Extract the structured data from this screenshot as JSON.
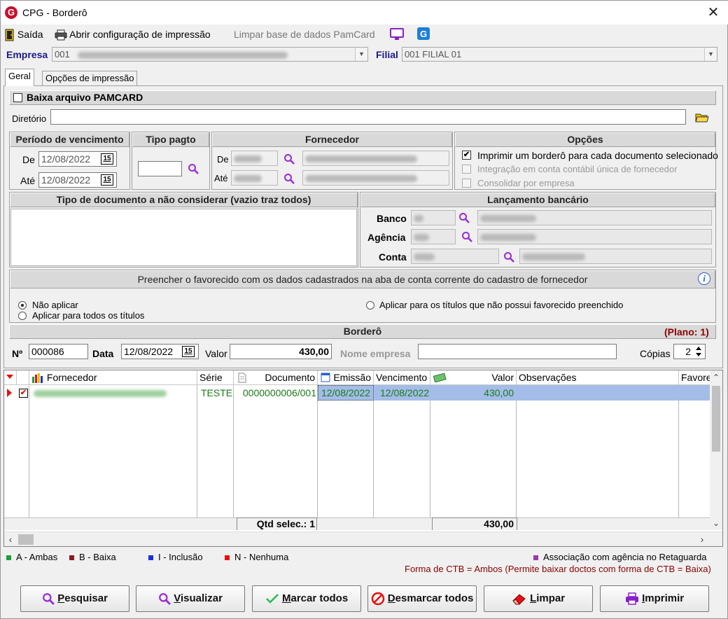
{
  "window": {
    "title": "CPG - Borderô",
    "close_glyph": "✕"
  },
  "toolbar": {
    "exit_label": "Saída",
    "print_config_label": "Abrir configuração de impressão",
    "clear_pamcard_label": "Limpar base de dados PamCard"
  },
  "company": {
    "empresa_label": "Empresa",
    "empresa_code": "001",
    "filial_label": "Filial",
    "filial_value": "001 FILIAL 01"
  },
  "tabs": [
    {
      "label": "Geral",
      "active": true
    },
    {
      "label": "Opções de impressão",
      "active": false
    }
  ],
  "pamcard": {
    "checkbox_label": "Baixa arquivo PAMCARD",
    "checked": false,
    "directory_label": "Diretório",
    "directory_value": ""
  },
  "periodo": {
    "title": "Período de vencimento",
    "from_label": "De",
    "from_value": "12/08/2022",
    "to_label": "Até",
    "to_value": "12/08/2022",
    "calendar_glyph": "15"
  },
  "tipo_pagto": {
    "title": "Tipo pagto",
    "value": ""
  },
  "fornecedor_filter": {
    "title": "Fornecedor",
    "from_label": "De",
    "to_label": "Até"
  },
  "opcoes": {
    "title": "Opções",
    "items": [
      {
        "label": "Imprimir um borderô para cada documento selecionado",
        "checked": true,
        "enabled": true
      },
      {
        "label": "Integração em conta contábil única de fornecedor",
        "checked": false,
        "enabled": false
      },
      {
        "label": "Consolidar por empresa",
        "checked": false,
        "enabled": false
      }
    ]
  },
  "tipo_documento": {
    "title": "Tipo de documento a não considerar (vazio traz todos)"
  },
  "lancamento": {
    "title": "Lançamento bancário",
    "banco_label": "Banco",
    "agencia_label": "Agência",
    "conta_label": "Conta"
  },
  "favorecido": {
    "title": "Preencher o favorecido com os dados cadastrados na aba de conta corrente do cadastro de fornecedor",
    "info_glyph": "i",
    "options": [
      {
        "label": "Não aplicar",
        "selected": true
      },
      {
        "label": "Aplicar para todos os títulos",
        "selected": false
      },
      {
        "label": "Aplicar para os títulos que não possui favorecido preenchido",
        "selected": false
      }
    ]
  },
  "bordero": {
    "title": "Borderô",
    "plano": "(Plano: 1)",
    "numero_label": "Nº",
    "numero_value": "000086",
    "data_label": "Data",
    "data_value": "12/08/2022",
    "valor_label": "Valor",
    "valor_value": "430,00",
    "nome_empresa_label": "Nome empresa",
    "nome_empresa_value": "",
    "copias_label": "Cópias",
    "copias_value": "2"
  },
  "grid": {
    "columns": [
      "Fornecedor",
      "Série",
      "Documento",
      "Emissão",
      "Vencimento",
      "Valor",
      "Observações",
      "Favore"
    ],
    "rows": [
      {
        "serie": "TESTE",
        "documento": "0000000006/001",
        "emissao": "12/08/2022",
        "vencimento": "12/08/2022",
        "valor": "430,00",
        "observacoes": "",
        "selected": true
      }
    ],
    "footer_qtd": "Qtd selec.: 1",
    "footer_valor": "430,00"
  },
  "legend": {
    "items": [
      {
        "label": "A - Ambas",
        "color": "#1e9e3a"
      },
      {
        "label": "B - Baixa",
        "color": "#8b1a1a"
      },
      {
        "label": "I - Inclusão",
        "color": "#1c2fe0"
      },
      {
        "label": "N - Nenhuma",
        "color": "#e81010"
      }
    ],
    "assoc_label": "Associação com agência no Retaguarda",
    "assoc_color": "#9b3aa8",
    "ctb_note": "Forma de CTB = Ambos (Permite baixar doctos com forma de CTB = Baixa)"
  },
  "buttons": {
    "pesquisar": {
      "hot": "P",
      "rest": "esquisar"
    },
    "visualizar": {
      "hot": "V",
      "rest": "isualizar"
    },
    "marcar": {
      "hot": "M",
      "rest": "arcar todos"
    },
    "desmarcar": {
      "hot": "D",
      "rest": "esmarcar todos"
    },
    "limpar": {
      "hot": "L",
      "rest": "impar"
    },
    "imprimir": {
      "hot": "I",
      "rest": "mprimir"
    }
  },
  "colors": {
    "green_text": "#1a7a1a",
    "selected_row": "#a4bde8",
    "header_red": "#8b0000"
  }
}
